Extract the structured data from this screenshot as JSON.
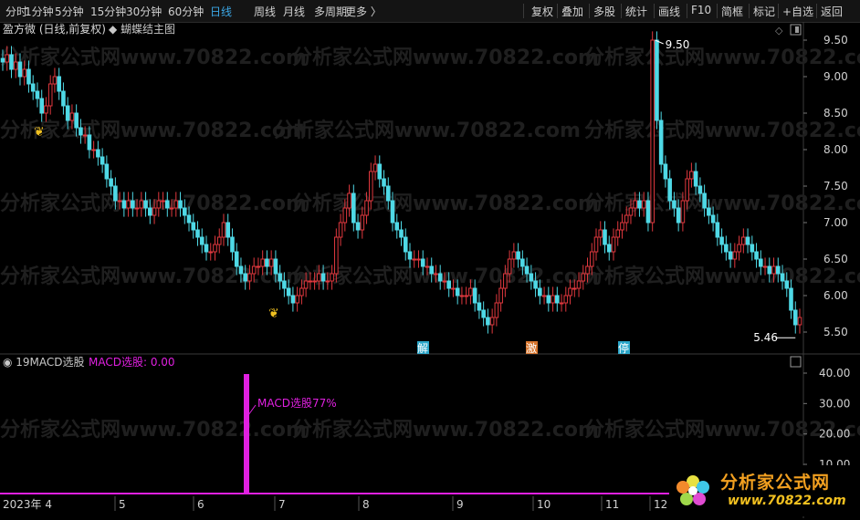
{
  "toolbar": {
    "periods": [
      "分时",
      "1分钟",
      "5分钟",
      "15分钟",
      "30分钟",
      "60分钟",
      "日线",
      "周线",
      "月线",
      "多周期",
      "更多 〉"
    ],
    "active_period": "日线",
    "right": [
      "复权",
      "叠加",
      "多股",
      "统计",
      "画线",
      "F10",
      "简框",
      "标记",
      "+自选",
      "返回"
    ]
  },
  "main_panel": {
    "stock_label": "盈方微 (日线,前复权)",
    "indicator": "蝴蝶结主图",
    "high_label": "9.50",
    "low_label": "5.46",
    "price_axis": [
      "9.50",
      "9.00",
      "8.50",
      "8.00",
      "7.50",
      "7.00",
      "6.50",
      "6.00",
      "5.50"
    ],
    "events": [
      {
        "text": "解",
        "color": "#2aa6c9"
      },
      {
        "text": "激",
        "color": "#d6742c"
      },
      {
        "text": "停",
        "color": "#2aa6c9"
      }
    ]
  },
  "sub_panel": {
    "name": "19MACD选股",
    "value_label": "MACD选股: 0.00",
    "annotation": "MACD选股77%",
    "axis": [
      "40.00",
      "30.00",
      "20.00",
      "10.00"
    ]
  },
  "date_axis": [
    "2023年 4",
    "5",
    "6",
    "7",
    "8",
    "9",
    "10",
    "11",
    "12"
  ],
  "watermark": "分析家公式网www.70822.com",
  "logo": {
    "cn": "分析家公式网",
    "url": "www.70822.com"
  },
  "colors": {
    "up": "#e0383e",
    "down": "#4fd9e6",
    "magenta": "#e020e0",
    "bg": "#000000"
  },
  "chart_data": {
    "type": "candlestick",
    "price_range": [
      5.46,
      9.5
    ],
    "ylim": [
      5.3,
      9.6
    ],
    "closes": [
      9.2,
      9.3,
      9.1,
      9.2,
      9.0,
      9.1,
      8.9,
      8.8,
      8.7,
      8.5,
      8.6,
      8.9,
      9.0,
      8.8,
      8.6,
      8.4,
      8.5,
      8.3,
      8.2,
      8.2,
      8.0,
      8.0,
      7.9,
      7.8,
      7.6,
      7.5,
      7.3,
      7.3,
      7.2,
      7.3,
      7.2,
      7.2,
      7.3,
      7.2,
      7.1,
      7.2,
      7.3,
      7.3,
      7.2,
      7.2,
      7.3,
      7.2,
      7.1,
      7.0,
      6.9,
      6.8,
      6.7,
      6.6,
      6.6,
      6.7,
      6.8,
      7.0,
      6.8,
      6.6,
      6.4,
      6.3,
      6.2,
      6.3,
      6.4,
      6.4,
      6.5,
      6.4,
      6.5,
      6.3,
      6.2,
      6.1,
      6.0,
      5.9,
      6.0,
      6.1,
      6.2,
      6.2,
      6.2,
      6.3,
      6.2,
      6.2,
      6.3,
      6.8,
      7.0,
      7.2,
      7.4,
      7.0,
      6.9,
      7.1,
      7.3,
      7.7,
      7.8,
      7.6,
      7.5,
      7.3,
      7.0,
      6.9,
      6.8,
      6.6,
      6.5,
      6.5,
      6.5,
      6.4,
      6.4,
      6.3,
      6.3,
      6.2,
      6.2,
      6.1,
      6.1,
      6.0,
      6.0,
      6.0,
      6.1,
      5.9,
      5.8,
      5.7,
      5.6,
      5.7,
      5.9,
      6.1,
      6.3,
      6.5,
      6.6,
      6.5,
      6.4,
      6.3,
      6.2,
      6.1,
      6.0,
      6.0,
      5.9,
      6.0,
      5.9,
      5.9,
      6.0,
      6.1,
      6.1,
      6.2,
      6.3,
      6.4,
      6.6,
      6.8,
      6.9,
      6.7,
      6.6,
      6.8,
      6.9,
      7.0,
      7.1,
      7.2,
      7.3,
      7.2,
      7.3,
      7.0,
      9.5,
      8.4,
      7.8,
      7.6,
      7.3,
      7.2,
      7.0,
      7.3,
      7.6,
      7.7,
      7.5,
      7.4,
      7.2,
      7.1,
      7.0,
      6.8,
      6.7,
      6.6,
      6.5,
      6.6,
      6.7,
      6.8,
      6.7,
      6.6,
      6.5,
      6.4,
      6.4,
      6.3,
      6.4,
      6.3,
      6.2,
      6.1,
      5.8,
      5.6,
      5.7
    ]
  }
}
